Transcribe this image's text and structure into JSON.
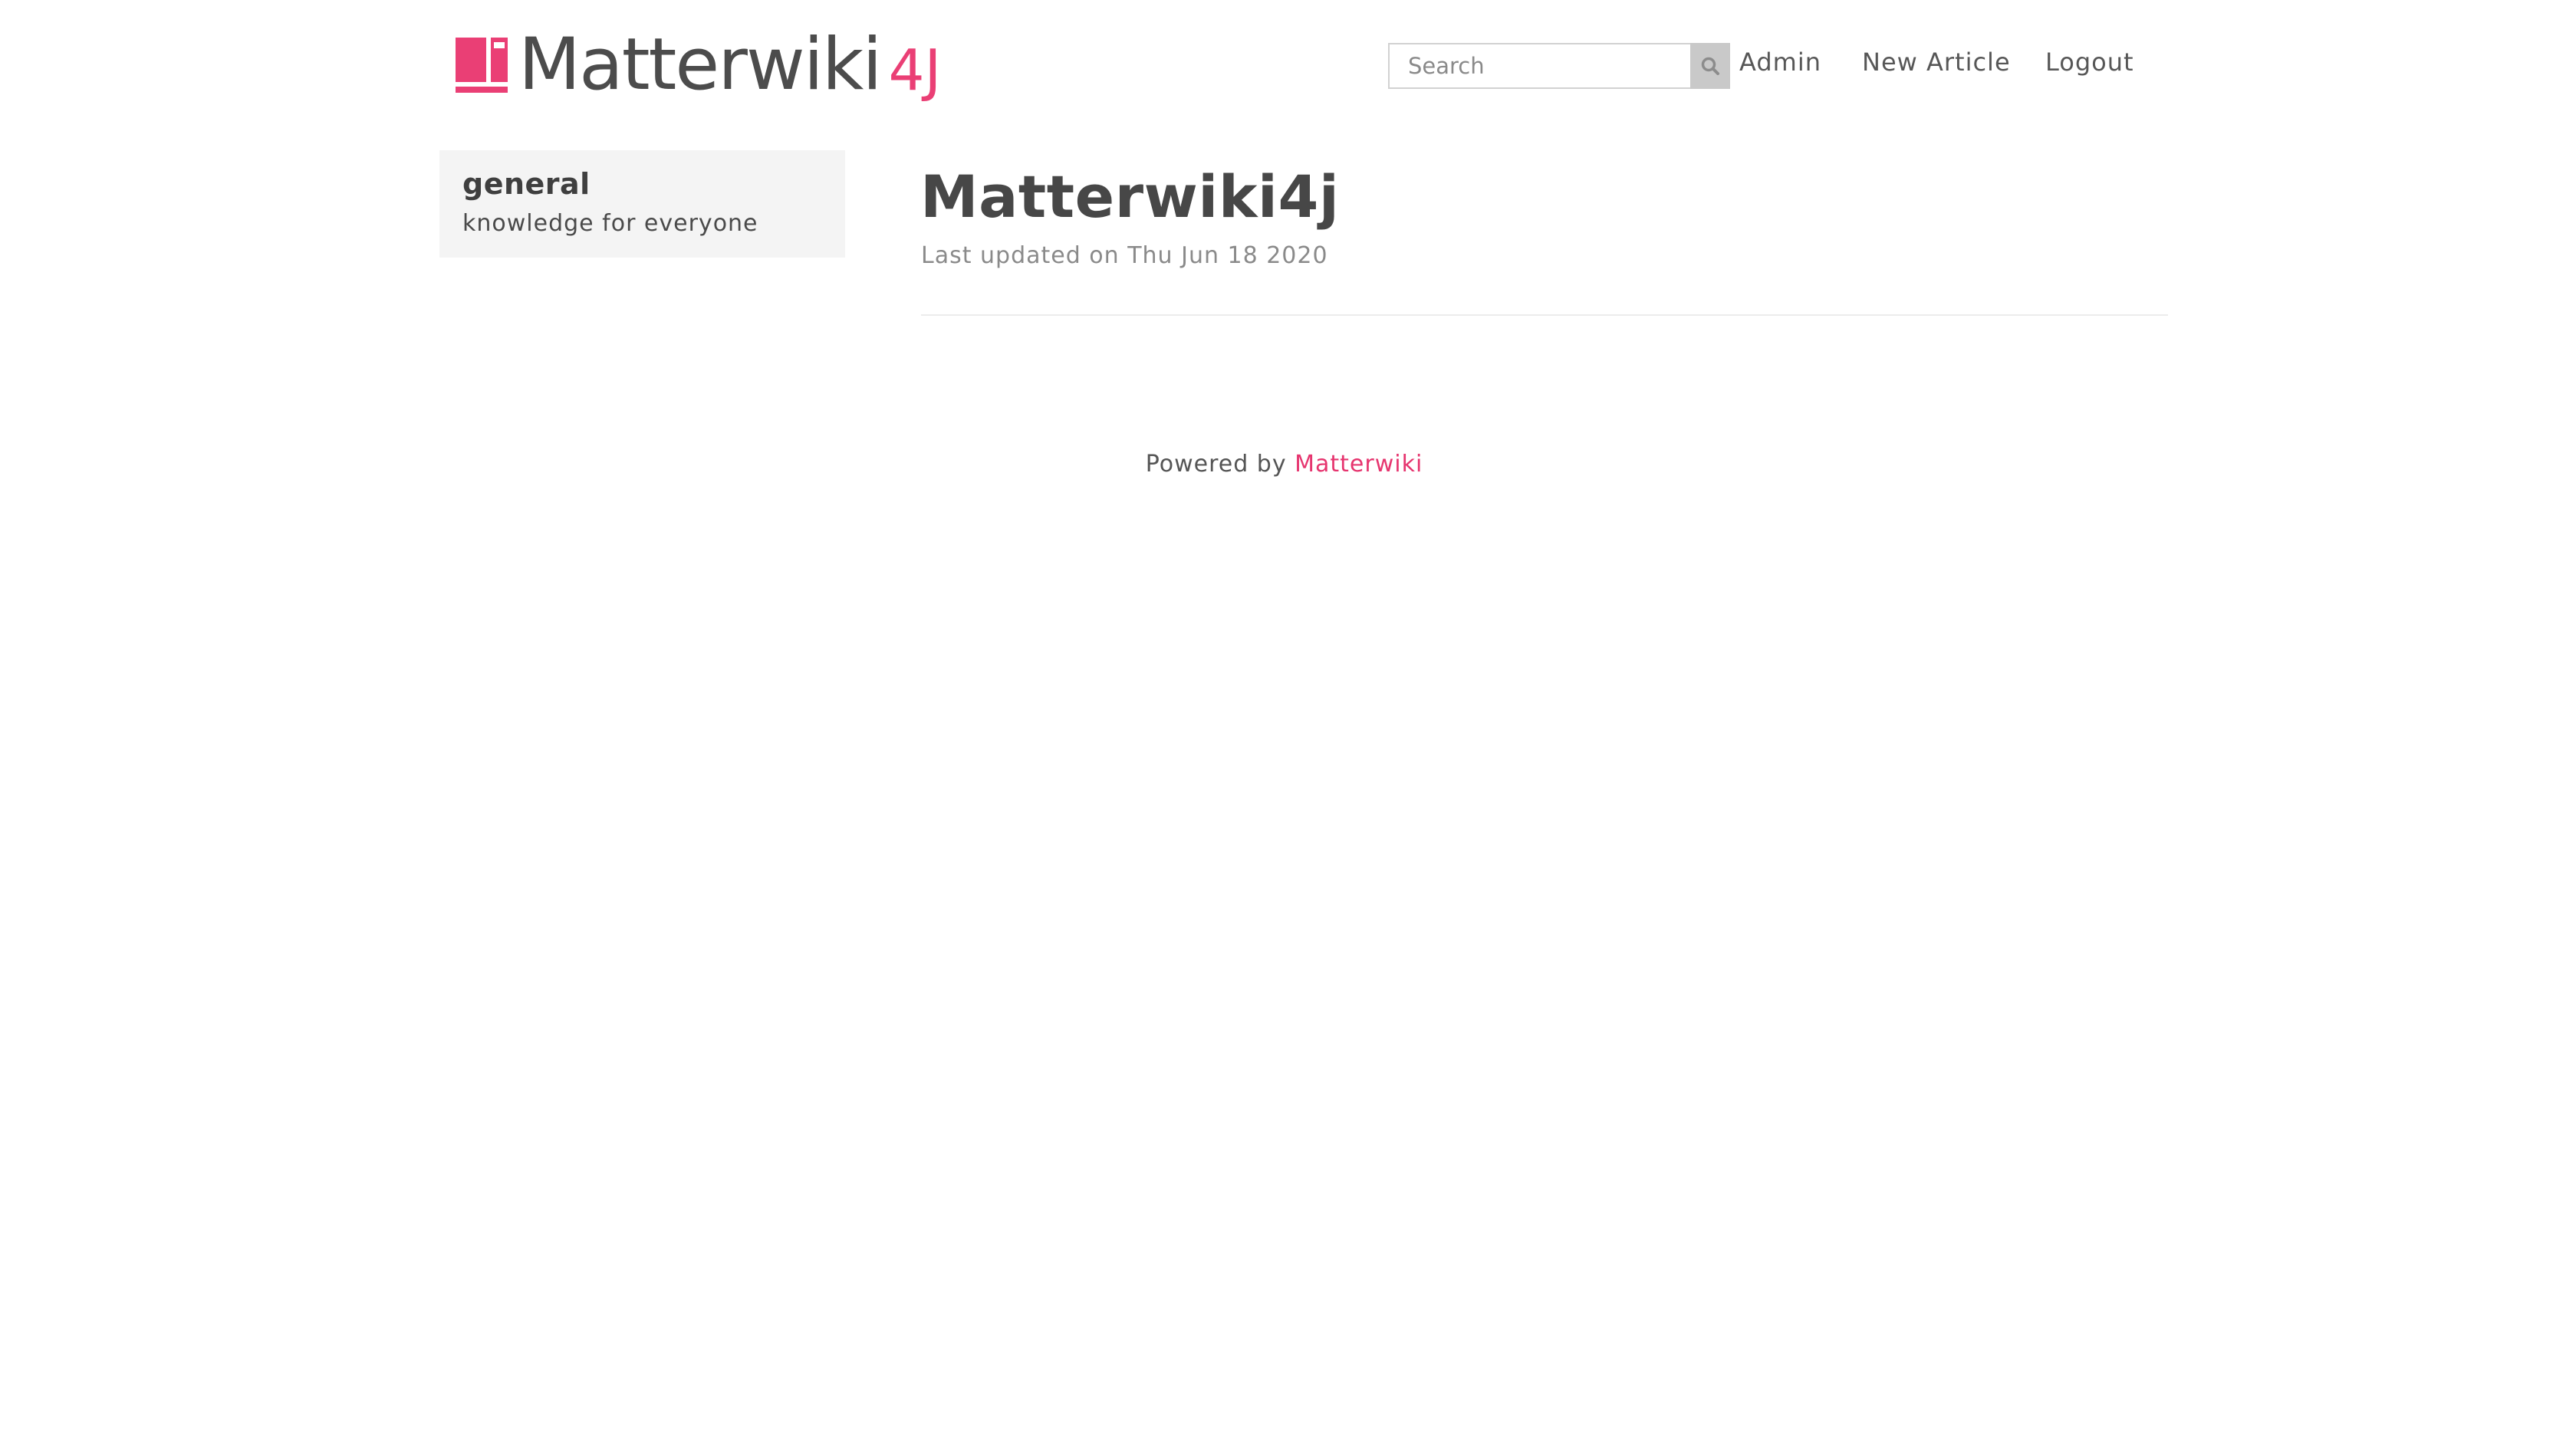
{
  "header": {
    "brand_name": "Matterwiki",
    "brand_suffix": "4J",
    "brand_color": "#ea3f75",
    "logo_icon": "book-stack-icon",
    "search": {
      "placeholder": "Search",
      "value": "",
      "icon": "search-icon"
    },
    "nav": {
      "admin_label": "Admin",
      "new_article_label": "New Article",
      "logout_label": "Logout"
    }
  },
  "sidebar": {
    "topics": [
      {
        "name": "general",
        "description": "knowledge for everyone"
      }
    ]
  },
  "article": {
    "title": "Matterwiki4j",
    "meta": "Last updated on Thu Jun 18 2020"
  },
  "footer": {
    "prefix": "Powered by",
    "link_label": "Matterwiki",
    "link_color": "#e6356f"
  }
}
